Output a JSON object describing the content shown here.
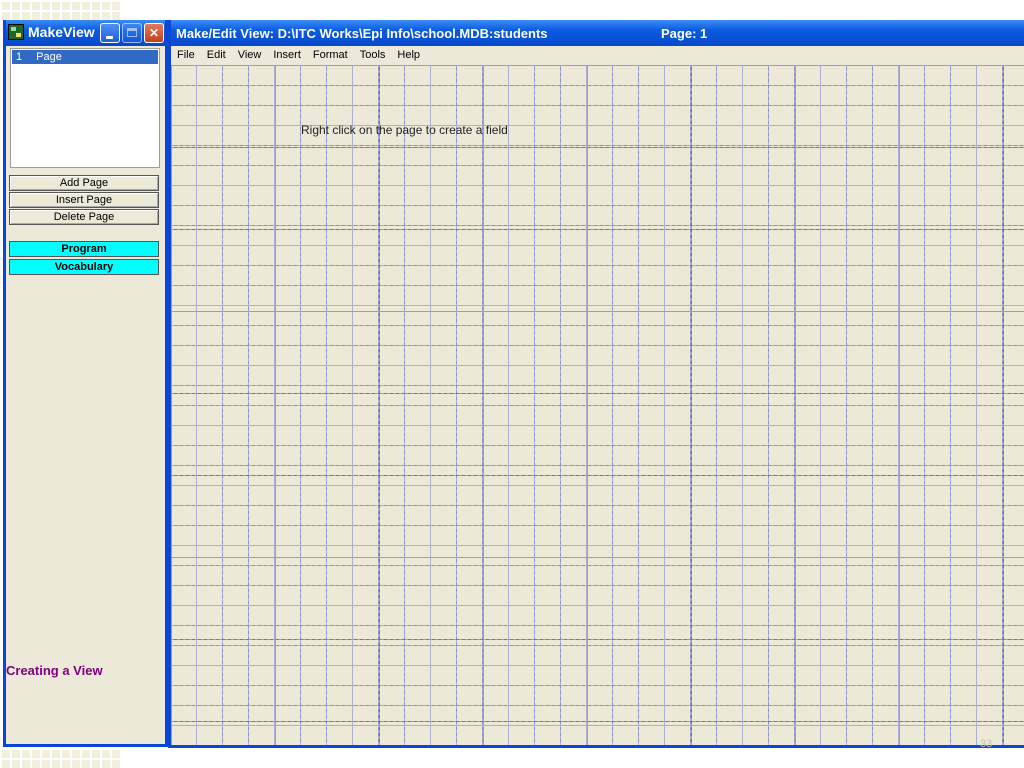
{
  "makeview": {
    "title": "MakeView",
    "page_list": [
      {
        "num": "1",
        "label": "Page"
      }
    ],
    "buttons": {
      "add_page": "Add Page",
      "insert_page": "Insert Page",
      "delete_page": "Delete Page",
      "program": "Program",
      "vocabulary": "Vocabulary"
    }
  },
  "caption": "Creating a View",
  "main": {
    "title": "Make/Edit View: D:\\ITC Works\\Epi Info\\school.MDB:students",
    "page_indicator": "Page: 1",
    "menu": [
      "File",
      "Edit",
      "View",
      "Insert",
      "Format",
      "Tools",
      "Help"
    ],
    "hint": "Right click on the page to create a field"
  },
  "slide_number": "33",
  "colors": {
    "titlebar": "#0a5ce0",
    "selection": "#316ac5",
    "cyan_button": "#00ffff",
    "caption": "#800080",
    "grid": "#5a78d6"
  }
}
